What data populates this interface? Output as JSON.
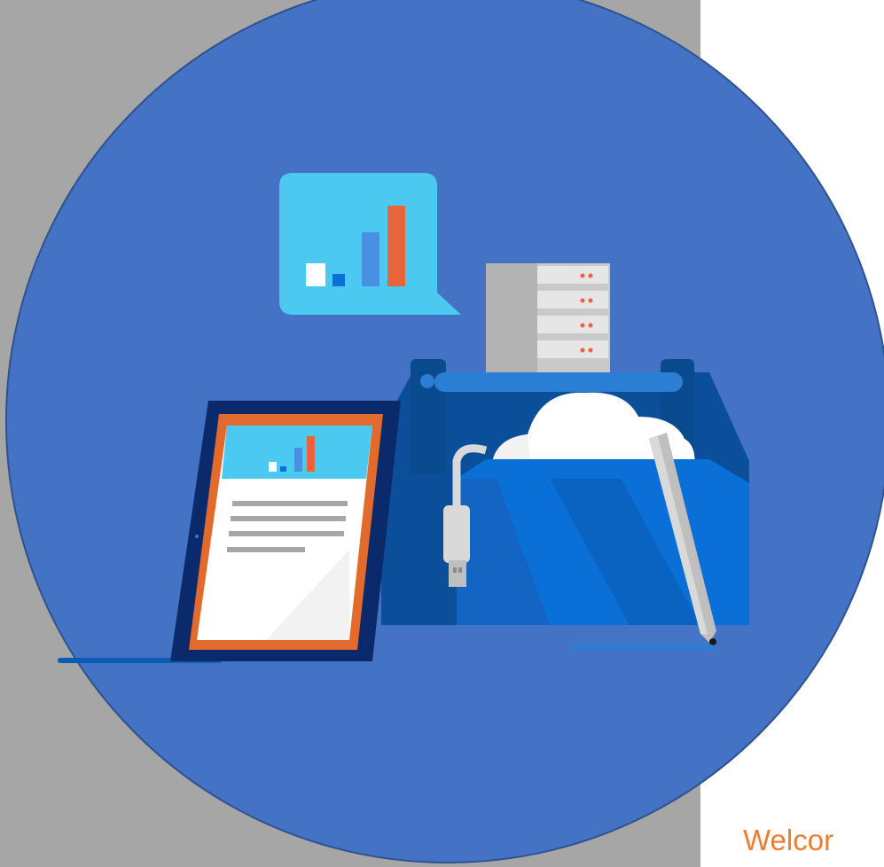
{
  "slide": {
    "welcome_text": "Welcor"
  },
  "colors": {
    "panel_gray": "#a6a6a6",
    "circle_blue": "#4472c4",
    "accent_orange": "#ed7d31",
    "light_blue": "#4cc9f0",
    "mid_blue": "#0a6fd6"
  },
  "illustration": {
    "icons": [
      "chat-bubble-chart-icon",
      "server-rack-icon",
      "toolbox-icon",
      "cloud-icon",
      "usb-cable-icon",
      "pen-icon",
      "tablet-icon"
    ]
  }
}
